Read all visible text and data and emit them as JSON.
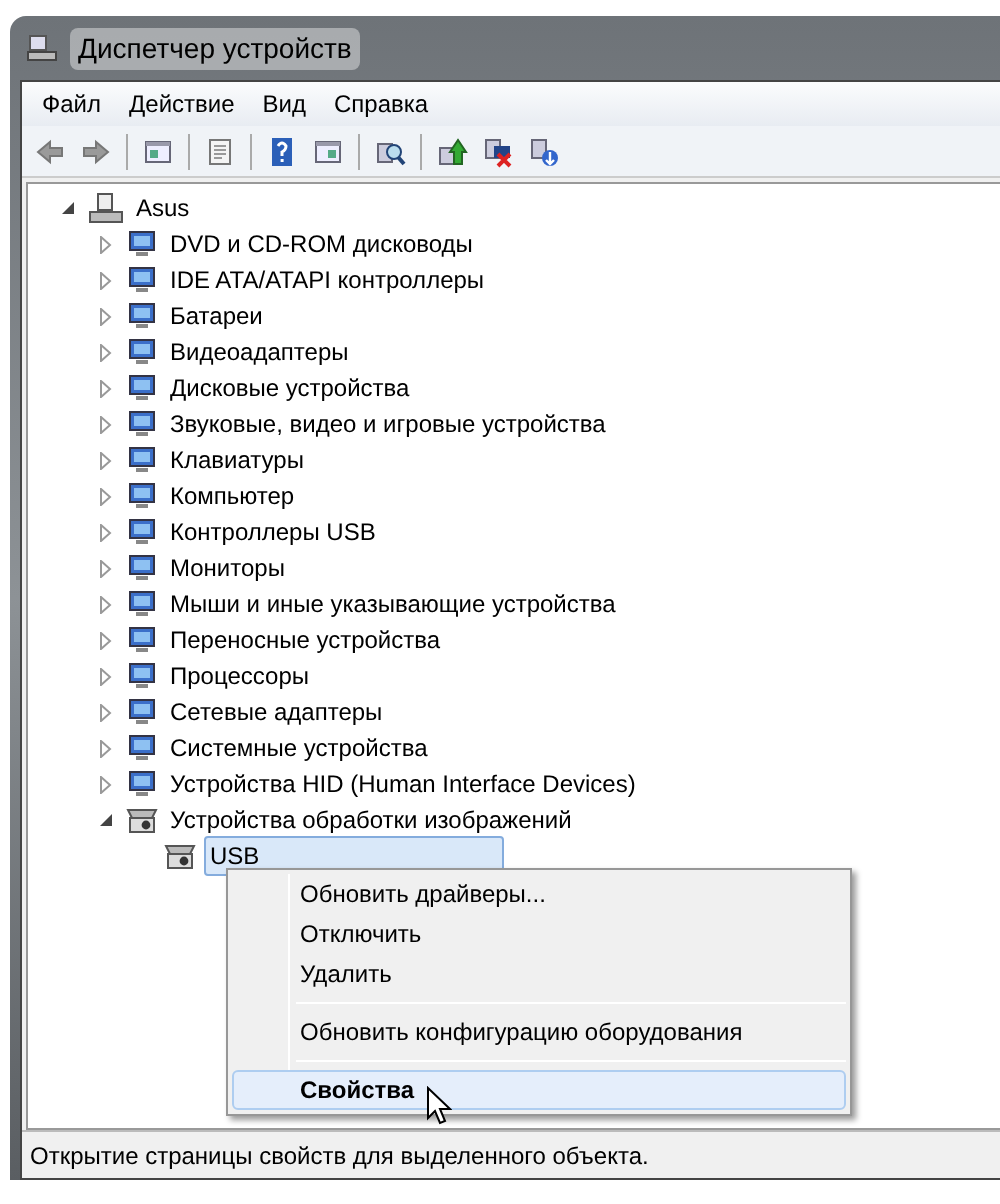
{
  "window": {
    "title": "Диспетчер устройств"
  },
  "menu_bar": [
    "Файл",
    "Действие",
    "Вид",
    "Справка"
  ],
  "tree": {
    "label": "Asus",
    "expanded": true,
    "children": [
      {
        "label": "DVD и CD-ROM дисководы",
        "expanded": false
      },
      {
        "label": "IDE ATA/ATAPI контроллеры",
        "expanded": false
      },
      {
        "label": "Батареи",
        "expanded": false
      },
      {
        "label": "Видеоадаптеры",
        "expanded": false
      },
      {
        "label": "Дисковые устройства",
        "expanded": false
      },
      {
        "label": "Звуковые, видео и игровые устройства",
        "expanded": false
      },
      {
        "label": "Клавиатуры",
        "expanded": false
      },
      {
        "label": "Компьютер",
        "expanded": false
      },
      {
        "label": "Контроллеры USB",
        "expanded": false
      },
      {
        "label": "Мониторы",
        "expanded": false
      },
      {
        "label": "Мыши и иные указывающие устройства",
        "expanded": false
      },
      {
        "label": "Переносные устройства",
        "expanded": false
      },
      {
        "label": "Процессоры",
        "expanded": false
      },
      {
        "label": "Сетевые адаптеры",
        "expanded": false
      },
      {
        "label": "Системные устройства",
        "expanded": false
      },
      {
        "label": "Устройства HID (Human Interface Devices)",
        "expanded": false
      },
      {
        "label": "Устройства обработки изображений",
        "expanded": true,
        "children": [
          {
            "label": "USB",
            "selected": true
          }
        ]
      }
    ]
  },
  "context_menu": [
    {
      "kind": "item",
      "label": "Обновить драйверы...",
      "selected": false
    },
    {
      "kind": "item",
      "label": "Отключить",
      "selected": false
    },
    {
      "kind": "item",
      "label": "Удалить",
      "selected": false
    },
    {
      "kind": "separator"
    },
    {
      "kind": "item",
      "label": "Обновить конфигурацию оборудования",
      "selected": false
    },
    {
      "kind": "separator"
    },
    {
      "kind": "default",
      "label": "Свойства",
      "selected": true
    }
  ],
  "status_bar": "Открытие страницы свойств для выделенного объекта."
}
